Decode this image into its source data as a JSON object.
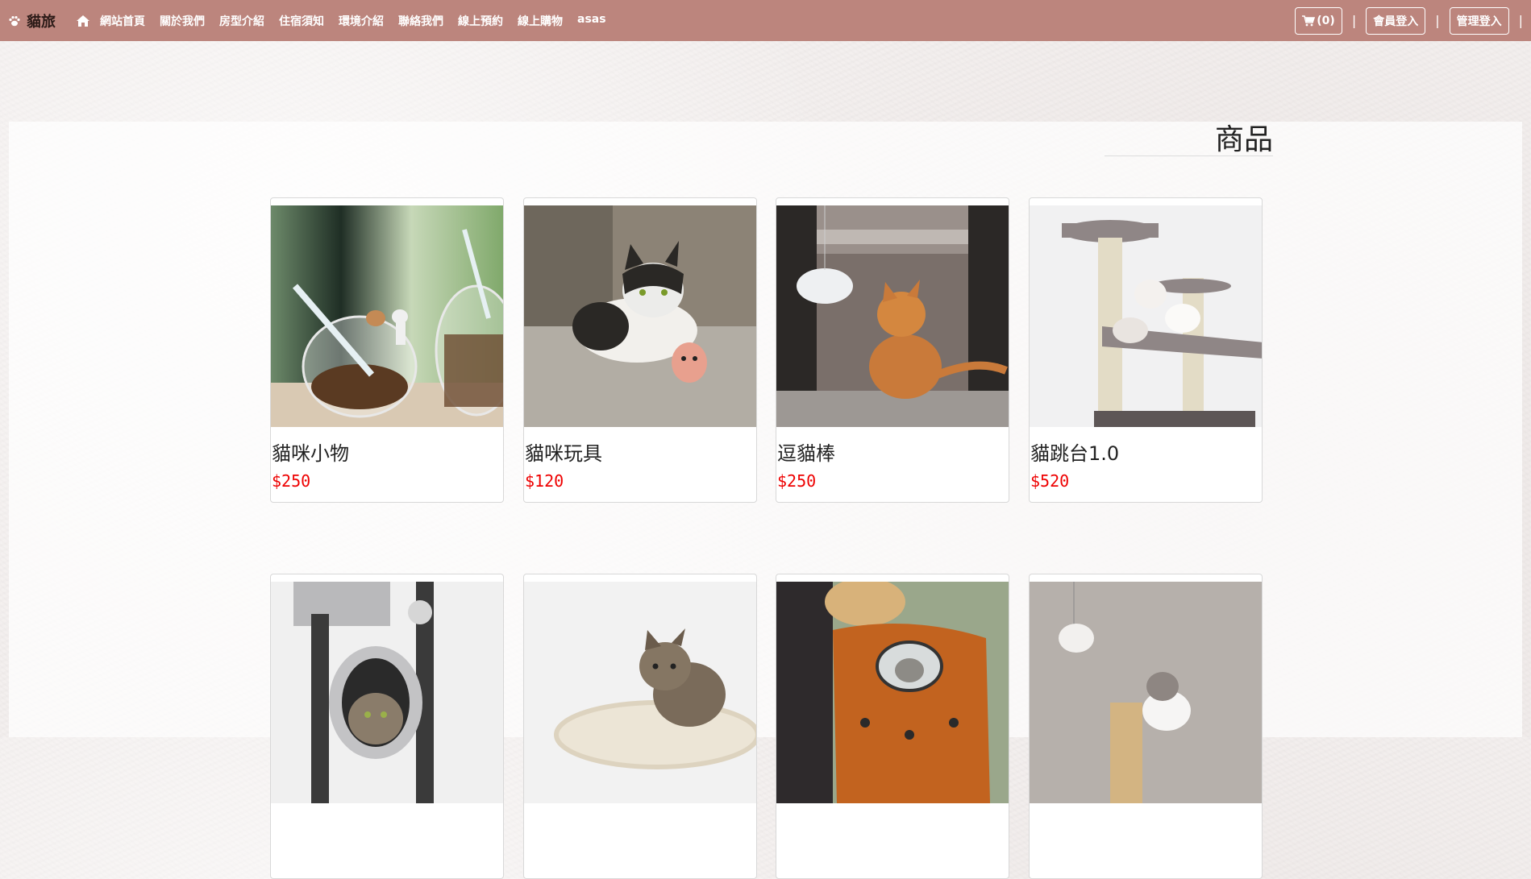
{
  "brand": {
    "name": "貓旅"
  },
  "nav": {
    "items": [
      "網站首頁",
      "關於我們",
      "房型介紹",
      "住宿須知",
      "環境介紹",
      "聯絡我們",
      "線上預約",
      "線上購物",
      "asas"
    ],
    "cart_label": "(0)",
    "member_login": "會員登入",
    "admin_login": "管理登入",
    "separator": "|"
  },
  "main": {
    "title": "商品",
    "products": [
      {
        "name": "貓咪小物",
        "price": "$250"
      },
      {
        "name": "貓咪玩具",
        "price": "$120"
      },
      {
        "name": "逗貓棒",
        "price": "$250"
      },
      {
        "name": "貓跳台1.0",
        "price": "$520"
      }
    ]
  },
  "colors": {
    "navbar": "#bc857d",
    "price": "#ee0000"
  }
}
